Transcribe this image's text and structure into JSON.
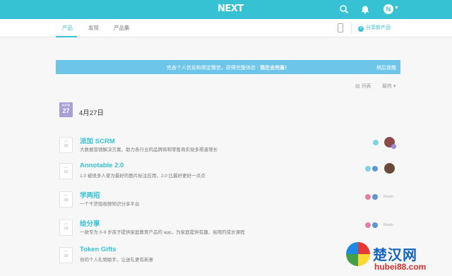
{
  "app": {
    "logo": "NEXT",
    "avatar_initial": "N"
  },
  "tabs": [
    {
      "label": "产品",
      "active": true
    },
    {
      "label": "发现",
      "active": false
    },
    {
      "label": "产品集",
      "active": false
    }
  ],
  "actions": {
    "share_product": "分享新产品"
  },
  "banner": {
    "text": "完善个人信息和绑定微信，获得完整体验 - ",
    "link": "现在去完善！",
    "dismiss": "稍后提醒"
  },
  "sort": {
    "view": "列表",
    "order": "最热"
  },
  "date": {
    "month": "APR",
    "day": "27",
    "title": "4月27日"
  },
  "products": [
    {
      "name": "派加 SCRM",
      "desc": "大数据营销解决方案，助力各行业的品牌商和零售商实现多渠道增长",
      "votes": "26"
    },
    {
      "name": "Annotable 2.0",
      "desc": "1.0 被很多人誉为最好的图片标注应用，2.0 比最好更好一点点",
      "votes": "22"
    },
    {
      "name": "学两招",
      "desc": "一个干货短视频知识分享平台",
      "votes": "15"
    },
    {
      "name": "绘分享",
      "desc": "一款专为 0-9 岁孩子提供家庭教育产品的 app，为家庭提供有趣、易用的成长课程",
      "votes": "13"
    },
    {
      "name": "Token Gifts",
      "desc": "你的个人礼物助手，让送礼更有新意",
      "votes": "10"
    }
  ],
  "hunter_labels": [
    "Kevin",
    "Kevin"
  ],
  "watermark": {
    "title": "楚汉网",
    "url": "hubei88.com"
  },
  "colors": {
    "brand": "#36c2d3",
    "banner": "#6dc6ea",
    "calendar": "#a89fd7"
  }
}
